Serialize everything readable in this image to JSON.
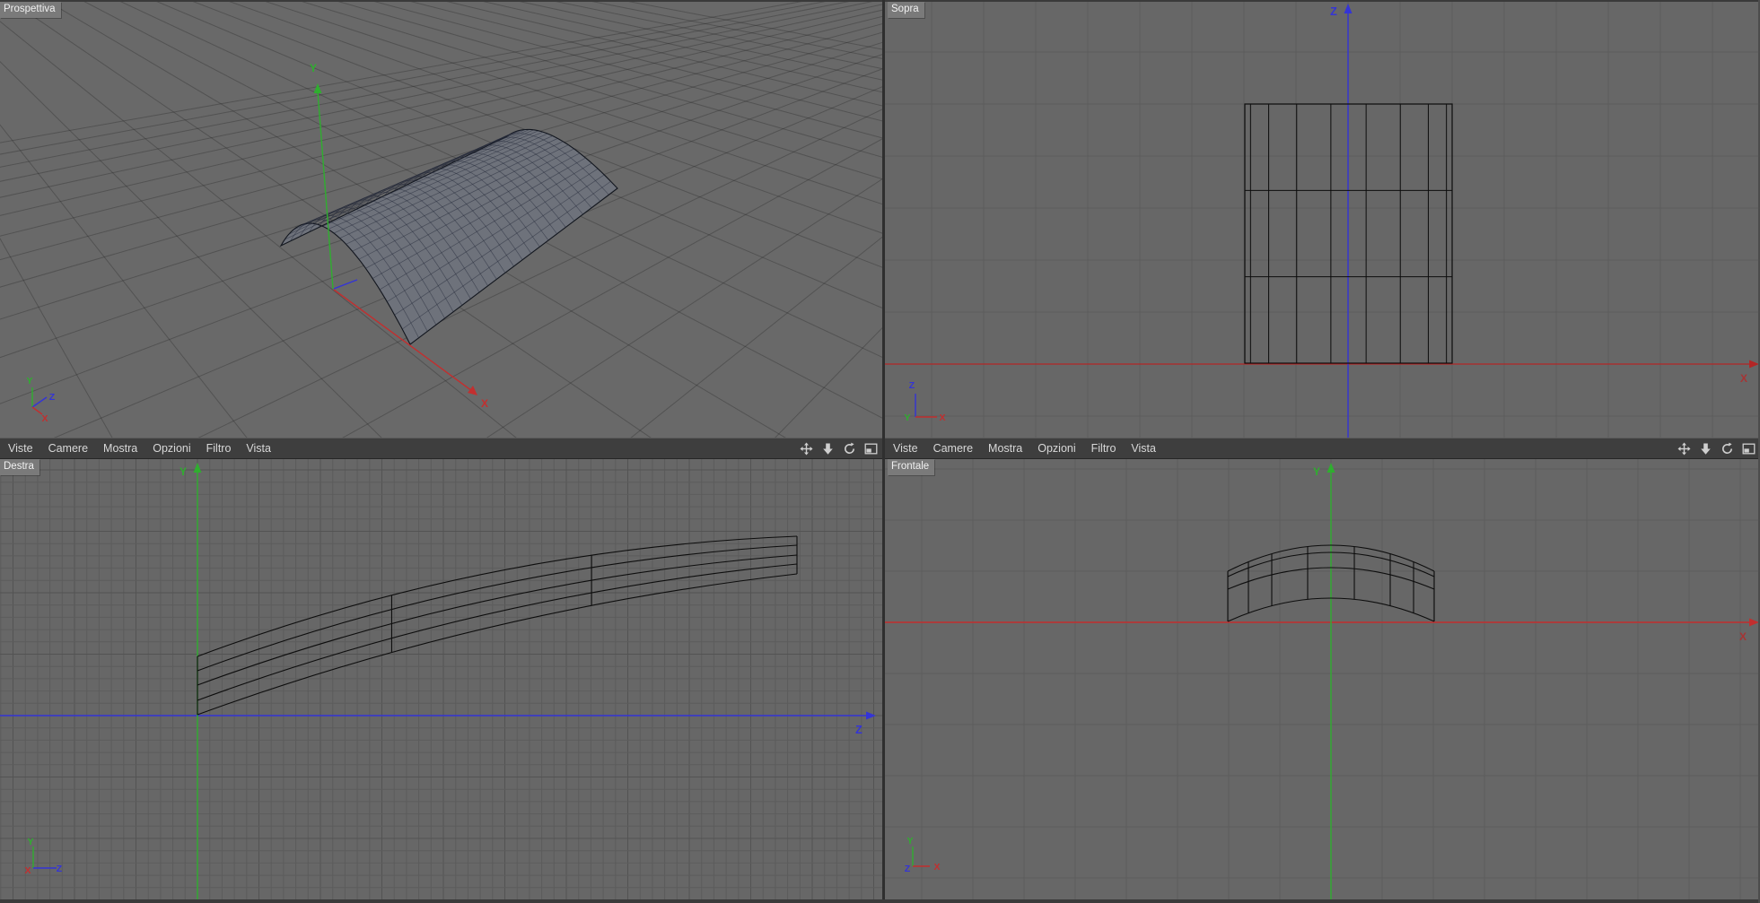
{
  "app": {
    "layout_name": "quad-viewport"
  },
  "viewports": [
    {
      "id": "perspective",
      "label": "Prospettiva"
    },
    {
      "id": "top",
      "label": "Sopra"
    },
    {
      "id": "right",
      "label": "Destra"
    },
    {
      "id": "front",
      "label": "Frontale"
    }
  ],
  "menu": {
    "items": [
      "Viste",
      "Camere",
      "Mostra",
      "Opzioni",
      "Filtro",
      "Vista"
    ],
    "icons": [
      "pan-icon",
      "dolly-icon",
      "rotate-icon",
      "toggle-layout-icon"
    ]
  },
  "axis_labels": {
    "x": "X",
    "y": "Y",
    "z": "Z"
  },
  "colors": {
    "axis_x": "#c22f2f",
    "axis_x_dim": "#a63434",
    "axis_y": "#2fae2f",
    "axis_z": "#3434d6",
    "viewport_bg": "#676767",
    "perspective_bg": "#696969",
    "menubar_bg": "#3e3e3e",
    "menu_text": "#d8d8d8",
    "tab_bg": "#7a7a7a",
    "tab_text": "#f0f0f0",
    "grid_line": "#5c5c5c",
    "grid_major": "#535353",
    "persp_grid": "rgba(25,25,25,0.28)",
    "wireframe": "#0d0d0d",
    "mesh_fill": "#6e727b",
    "mesh_line": "#232838",
    "icon_color": "#cfcfcf"
  }
}
